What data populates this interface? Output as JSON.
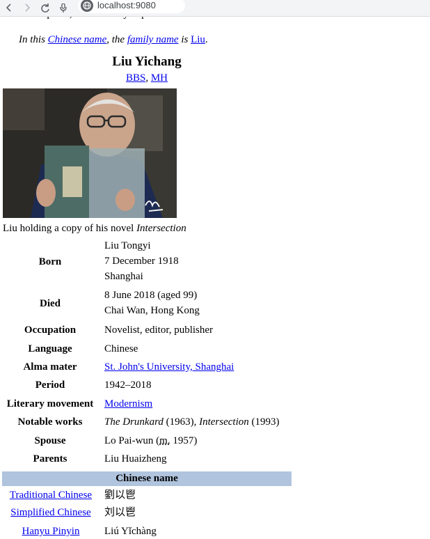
{
  "browser": {
    "url": "localhost:9080"
  },
  "page": {
    "source_line": "From Wikipedia, the free encyclopedia",
    "hatnote": {
      "prefix": "In this ",
      "link1": "Chinese name",
      "mid": ", the ",
      "link2": "family name",
      "is": " is ",
      "link3": "Liu",
      "end": "."
    }
  },
  "infobox": {
    "title": "Liu Yichang",
    "sub_link1": "BBS",
    "sub_sep": ", ",
    "sub_link2": "MH",
    "image_alt": "Liu Yichang portrait",
    "caption_prefix": "Liu holding a copy of his novel ",
    "caption_italic": "Intersection",
    "rows": {
      "born": {
        "label": "Born",
        "lines": [
          "Liu Tongyi",
          "7 December 1918",
          "Shanghai"
        ]
      },
      "died": {
        "label": "Died",
        "lines": [
          "8 June 2018 (aged 99)",
          "Chai Wan, Hong Kong"
        ]
      },
      "occupation": {
        "label": "Occupation",
        "value": "Novelist, editor, publisher"
      },
      "language": {
        "label": "Language",
        "value": "Chinese"
      },
      "alma_mater": {
        "label": "Alma mater",
        "value": "St. John's University, Shanghai"
      },
      "period": {
        "label": "Period",
        "value": "1942–2018"
      },
      "movement": {
        "label": "Literary movement",
        "value": "Modernism"
      },
      "notable": {
        "label": "Notable works",
        "work1": "The Drunkard",
        "work1_year": " (1963), ",
        "work2": "Intersection",
        "work2_year": " (1993)"
      },
      "spouse": {
        "label": "Spouse",
        "name": "Lo Pai-wun (",
        "abbr": "m.",
        "year": " 1957)"
      },
      "parents": {
        "label": "Parents",
        "value": "Liu Huaizheng"
      }
    },
    "chinese_name": {
      "header": "Chinese name",
      "rows": [
        {
          "label": "Traditional Chinese",
          "value": "劉以鬯"
        },
        {
          "label": "Simplified Chinese",
          "value": "刘以鬯"
        },
        {
          "label": "Hanyu Pinyin",
          "value": "Liú Yǐchàng"
        }
      ]
    }
  }
}
